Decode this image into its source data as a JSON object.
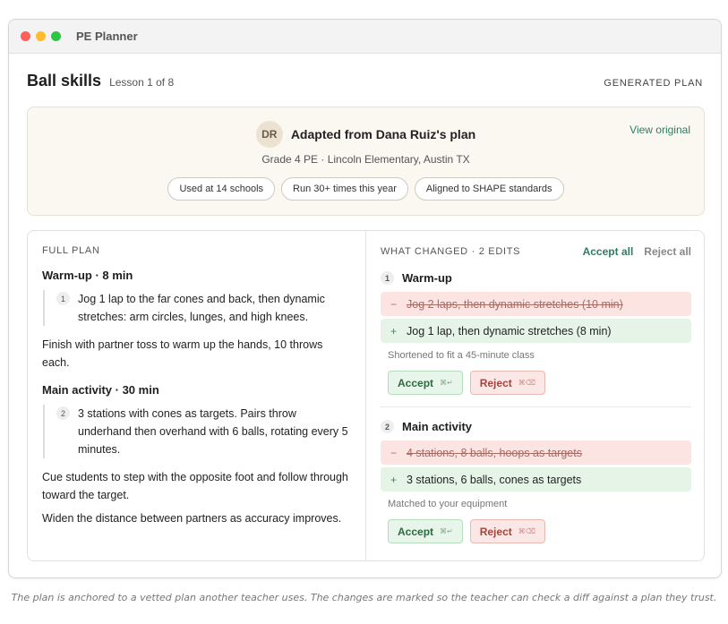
{
  "window": {
    "app_title": "PE Planner",
    "controls": [
      "close",
      "minimize",
      "zoom"
    ]
  },
  "header": {
    "title": "Ball skills",
    "subtitle": "Lesson 1 of 8",
    "badge": "GENERATED PLAN"
  },
  "source": {
    "avatar_initials": "DR",
    "title": "Adapted from Dana Ruiz's plan",
    "meta": "Grade 4 PE · Lincoln Elementary, Austin TX",
    "view_link": "View original",
    "pills": [
      "Used at 14 schools",
      "Run 30+ times this year",
      "Aligned to SHAPE standards"
    ]
  },
  "full_plan": {
    "label": "FULL PLAN",
    "sections": [
      {
        "heading": "Warm-up · 8 min",
        "step_num": "1",
        "step_text": "Jog 1 lap to the far cones and back, then dynamic stretches: arm circles, lunges, and high knees.",
        "paras": [
          "Finish with partner toss to warm up the hands, 10 throws each."
        ]
      },
      {
        "heading": "Main activity · 30 min",
        "step_num": "2",
        "step_text": "3 stations with cones as targets. Pairs throw underhand then overhand with 6 balls, rotating every 5 minutes.",
        "paras": [
          "Cue students to step with the opposite foot and follow through toward the target.",
          "Widen the distance between partners as accuracy improves."
        ]
      }
    ]
  },
  "changes": {
    "label": "WHAT CHANGED · 2 EDITS",
    "accept_all": "Accept all",
    "reject_all": "Reject all",
    "edits": [
      {
        "num": "1",
        "title": "Warm-up",
        "removed": "Jog 2 laps, then dynamic stretches (10 min)",
        "added": "Jog 1 lap, then dynamic stretches (8 min)",
        "note": "Shortened to fit a 45-minute class",
        "accept": "Accept",
        "reject": "Reject",
        "accept_kbd": "⌘↵",
        "reject_kbd": "⌘⌫"
      },
      {
        "num": "2",
        "title": "Main activity",
        "removed": "4 stations, 8 balls, hoops as targets",
        "added": "3 stations, 6 balls, cones as targets",
        "note": "Matched to your equipment",
        "accept": "Accept",
        "reject": "Reject",
        "accept_kbd": "⌘↵",
        "reject_kbd": "⌘⌫"
      }
    ],
    "minus_sign": "−",
    "plus_sign": "+"
  },
  "caption": "The plan is anchored to a vetted plan another teacher uses. The changes are marked so the teacher can check a diff against a plan they trust.",
  "colors": {
    "accent_green": "#2e7d62",
    "removed_bg": "#fbe4e2",
    "added_bg": "#e6f4e8",
    "source_card_bg": "#fbf8f2"
  }
}
